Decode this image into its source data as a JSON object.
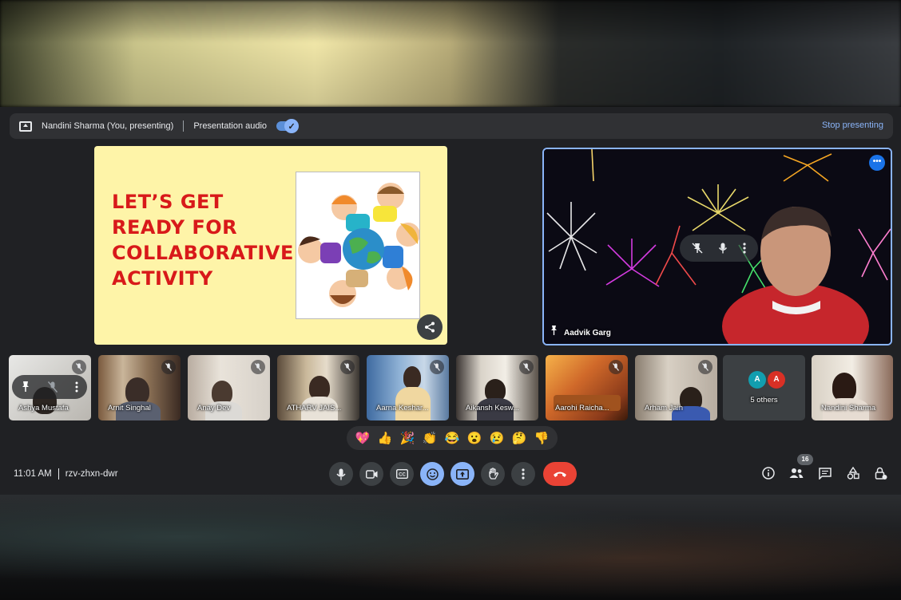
{
  "presentation_bar": {
    "presenter": "Nandini Sharma (You, presenting)",
    "audio_label": "Presentation audio",
    "audio_on": true,
    "stop_label": "Stop presenting"
  },
  "slide": {
    "lines": [
      "LET’S GET",
      "READY FOR",
      "COLLABORATIVE",
      "ACTIVITY"
    ]
  },
  "featured": {
    "name": "Aadvik Garg"
  },
  "participants": [
    {
      "name": "Ashya Mustafa",
      "muted": true
    },
    {
      "name": "Arnit Singhal",
      "muted": true
    },
    {
      "name": "Anay Dev",
      "muted": true
    },
    {
      "name": "ATHARV JAIS...",
      "muted": true
    },
    {
      "name": "Aarna Keshar...",
      "muted": true
    },
    {
      "name": "Aikansh Kesw...",
      "muted": true
    },
    {
      "name": "Aarohi Raicha...",
      "muted": true
    },
    {
      "name": "Arham Jain",
      "muted": true
    },
    {
      "name": "5 others",
      "initials": [
        "A",
        "A"
      ]
    },
    {
      "name": "Nandini Sharma",
      "muted": false
    }
  ],
  "reactions": [
    "💖",
    "👍",
    "🎉",
    "👏",
    "😂",
    "😮",
    "😢",
    "🤔",
    "👎"
  ],
  "meeting": {
    "time": "11:01 AM",
    "code": "rzv-zhxn-dwr",
    "participant_count": "16"
  },
  "colors": {
    "accent": "#8ab4f8",
    "end_call": "#ea4335",
    "slide_bg": "#fef4a8",
    "slide_text": "#d8191a"
  }
}
